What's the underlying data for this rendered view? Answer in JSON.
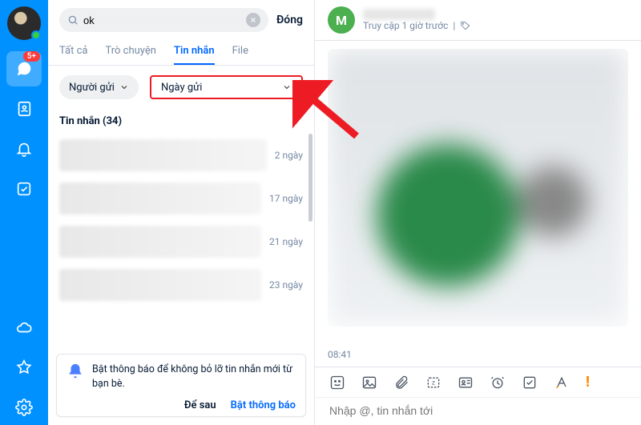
{
  "colors": {
    "accent": "#0091ff",
    "highlight_box": "#ed1c24",
    "badge": "#ff3a3a"
  },
  "navrail": {
    "badge": "5+",
    "icons": [
      "chat",
      "contacts",
      "bell",
      "todo",
      "cloud",
      "star",
      "settings"
    ]
  },
  "search": {
    "value": "ok",
    "close": "Đóng"
  },
  "tabs": [
    {
      "label": "Tất cả",
      "active": false
    },
    {
      "label": "Trò chuyện",
      "active": false
    },
    {
      "label": "Tin nhắn",
      "active": true
    },
    {
      "label": "File",
      "active": false
    }
  ],
  "filters": {
    "sender": "Người gửi",
    "date": "Ngày gửi"
  },
  "results": {
    "section_title": "Tin nhắn (34)",
    "items": [
      {
        "time": "2 ngày"
      },
      {
        "time": "17 ngày"
      },
      {
        "time": "21 ngày"
      },
      {
        "time": "23 ngày"
      }
    ]
  },
  "notification": {
    "text": "Bật thông báo để không bỏ lỡ tin nhắn mới từ bạn bè.",
    "later": "Để sau",
    "enable": "Bật thông báo"
  },
  "chat": {
    "avatar_letter": "M",
    "status": "Truy cập 1 giờ trước",
    "time_label": "08:41"
  },
  "composer": {
    "placeholder": "Nhập @, tin nhắn tới",
    "toolbar_icons": [
      "sticker",
      "image",
      "attachment",
      "screenshot",
      "contact-card",
      "alarm",
      "task",
      "format",
      "priority"
    ]
  }
}
